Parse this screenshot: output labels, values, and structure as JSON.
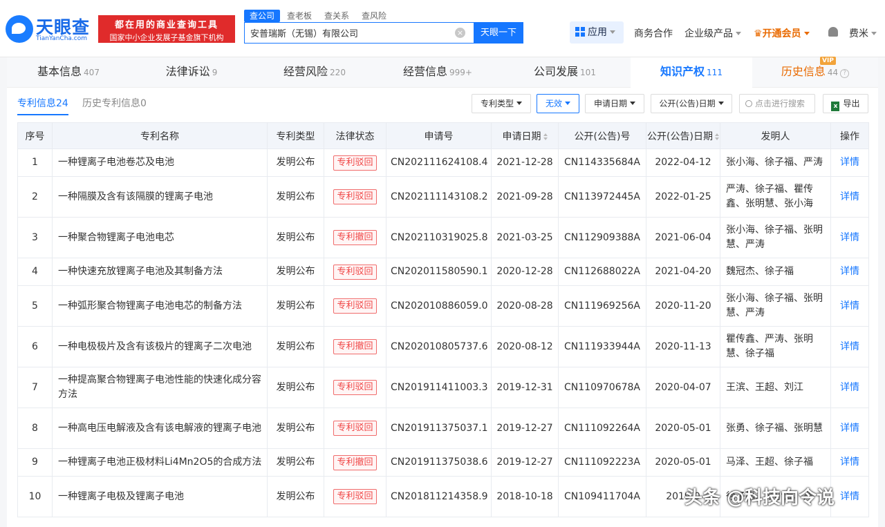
{
  "header": {
    "logo_text": "天眼查",
    "logo_sub": "TianYanCha.com",
    "banner_line1": "都在用的商业查询工具",
    "banner_line2": "国家中小企业发展子基金旗下机构",
    "search_tabs": [
      "查公司",
      "查老板",
      "查关系",
      "查风险"
    ],
    "search_value": "安普瑞斯（无锡）有限公司",
    "search_button": "天眼一下",
    "app_label": "应用",
    "nav": [
      "商务合作",
      "企业级产品",
      "开通会员",
      "费米"
    ]
  },
  "tabs": [
    {
      "label": "基本信息",
      "count": "407"
    },
    {
      "label": "法律诉讼",
      "count": "9"
    },
    {
      "label": "经营风险",
      "count": "220"
    },
    {
      "label": "经营信息",
      "count": "999+"
    },
    {
      "label": "公司发展",
      "count": "101"
    },
    {
      "label": "知识产权",
      "count": "111"
    },
    {
      "label": "历史信息",
      "count": "44"
    }
  ],
  "vip_badge": "VIP",
  "subtabs": [
    {
      "label": "专利信息",
      "count": "24"
    },
    {
      "label": "历史专利信息",
      "count": "0"
    }
  ],
  "filters": {
    "type": "专利类型",
    "invalid": "无效",
    "apply_date": "申请日期",
    "pub_date": "公开(公告)日期",
    "search_placeholder": "点击进行搜索",
    "export": "导出"
  },
  "columns": [
    "序号",
    "专利名称",
    "专利类型",
    "法律状态",
    "申请号",
    "申请日期",
    "公开(公告)号",
    "公开(公告)日期",
    "发明人",
    "操作"
  ],
  "rows": [
    {
      "no": "1",
      "name": "一种锂离子电池卷芯及电池",
      "type": "发明公布",
      "status": "专利驳回",
      "app_no": "CN202111624108.4",
      "app_date": "2021-12-28",
      "pub_no": "CN114335684A",
      "pub_date": "2022-04-12",
      "inventors": "张小海、徐子福、严涛",
      "op": "详情"
    },
    {
      "no": "2",
      "name": "一种隔膜及含有该隔膜的锂离子电池",
      "type": "发明公布",
      "status": "专利驳回",
      "app_no": "CN202111143108.2",
      "app_date": "2021-09-28",
      "pub_no": "CN113972445A",
      "pub_date": "2022-01-25",
      "inventors": "严涛、徐子福、瞿传鑫、张明慧、张小海",
      "op": "详情"
    },
    {
      "no": "3",
      "name": "一种聚合物锂离子电池电芯",
      "type": "发明公布",
      "status": "专利撤回",
      "app_no": "CN202110319025.8",
      "app_date": "2021-03-25",
      "pub_no": "CN112909388A",
      "pub_date": "2021-06-04",
      "inventors": "张小海、徐子福、张明慧、严涛",
      "op": "详情"
    },
    {
      "no": "4",
      "name": "一种快速充放锂离子电池及其制备方法",
      "type": "发明公布",
      "status": "专利驳回",
      "app_no": "CN202011580590.1",
      "app_date": "2020-12-28",
      "pub_no": "CN112688022A",
      "pub_date": "2021-04-20",
      "inventors": "魏冠杰、徐子福",
      "op": "详情"
    },
    {
      "no": "5",
      "name": "一种弧形聚合物锂离子电池电芯的制备方法",
      "type": "发明公布",
      "status": "专利驳回",
      "app_no": "CN202010886059.0",
      "app_date": "2020-08-28",
      "pub_no": "CN111969256A",
      "pub_date": "2020-11-20",
      "inventors": "张小海、徐子福、张明慧、严涛",
      "op": "详情"
    },
    {
      "no": "6",
      "name": "一种电极极片及含有该极片的锂离子二次电池",
      "type": "发明公布",
      "status": "专利撤回",
      "app_no": "CN202010805737.6",
      "app_date": "2020-08-12",
      "pub_no": "CN111933944A",
      "pub_date": "2020-11-13",
      "inventors": "瞿传鑫、严涛、张明慧、徐子福",
      "op": "详情"
    },
    {
      "no": "7",
      "name": "一种提高聚合物锂离子电池性能的快速化成分容方法",
      "type": "发明公布",
      "status": "专利驳回",
      "app_no": "CN201911411003.3",
      "app_date": "2019-12-31",
      "pub_no": "CN110970678A",
      "pub_date": "2020-04-07",
      "inventors": "王滨、王超、刘江",
      "op": "详情"
    },
    {
      "no": "8",
      "name": "一种高电压电解液及含有该电解液的锂离子电池",
      "type": "发明公布",
      "status": "专利驳回",
      "app_no": "CN201911375037.1",
      "app_date": "2019-12-27",
      "pub_no": "CN111092264A",
      "pub_date": "2020-05-01",
      "inventors": "张勇、徐子福、张明慧",
      "op": "详情"
    },
    {
      "no": "9",
      "name": "一种锂离子电池正极材料Li4Mn2O5的合成方法",
      "type": "发明公布",
      "status": "专利撤回",
      "app_no": "CN201911375038.6",
      "app_date": "2019-12-27",
      "pub_no": "CN111092223A",
      "pub_date": "2020-05-01",
      "inventors": "马泽、王超、徐子福",
      "op": "详情"
    },
    {
      "no": "10",
      "name": "一种锂离子电极及锂离子电池",
      "type": "发明公布",
      "status": "专利驳回",
      "app_no": "CN201811214358.9",
      "app_date": "2018-10-18",
      "pub_no": "CN109411704A",
      "pub_date": "2019-0",
      "inventors": "徐子福、张小海、严",
      "op": "详情"
    }
  ],
  "watermark": "头条 @科技向令说"
}
